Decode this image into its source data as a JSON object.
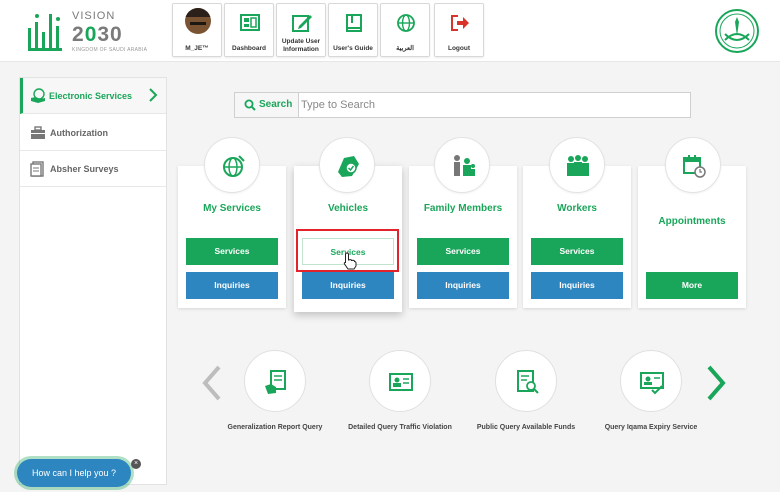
{
  "header": {
    "logo": {
      "vision_text": "VISION",
      "year_prefix": "2",
      "year_zero": "0",
      "year_suffix": "30",
      "kingdom_text": "KINGDOM OF SAUDI ARABIA"
    },
    "tiles": [
      {
        "label": "M_JE™",
        "icon": "avatar"
      },
      {
        "label": "Dashboard",
        "icon": "dashboard-icon"
      },
      {
        "label": "Update User Information",
        "icon": "edit-icon"
      },
      {
        "label": "User's Guide",
        "icon": "book-icon"
      },
      {
        "label": "العربية",
        "icon": "globe-icon"
      },
      {
        "label": "Logout",
        "icon": "logout-icon"
      }
    ]
  },
  "sidebar": {
    "items": [
      {
        "label": "Electronic Services",
        "icon": "hand-icon",
        "active": true
      },
      {
        "label": "Authorization",
        "icon": "briefcase-icon",
        "active": false
      },
      {
        "label": "Absher Surveys",
        "icon": "survey-icon",
        "active": false
      }
    ]
  },
  "search": {
    "button_label": "Search",
    "placeholder": "Type to Search"
  },
  "services": [
    {
      "title": "My Services",
      "primary": "Services",
      "secondary": "Inquiries",
      "icon": "globe-icon"
    },
    {
      "title": "Vehicles",
      "primary": "Services",
      "secondary": "Inquiries",
      "icon": "car-icon"
    },
    {
      "title": "Family Members",
      "primary": "Services",
      "secondary": "Inquiries",
      "icon": "family-icon"
    },
    {
      "title": "Workers",
      "primary": "Services",
      "secondary": "Inquiries",
      "icon": "workers-icon"
    },
    {
      "title": "Appointments",
      "more": "More",
      "icon": "calendar-icon"
    }
  ],
  "quick_access": [
    {
      "label": "Generalization Report Query",
      "icon": "report-icon"
    },
    {
      "label": "Detailed Query Traffic Violation",
      "icon": "id-card-icon"
    },
    {
      "label": "Public Query Available Funds",
      "icon": "document-search-icon"
    },
    {
      "label": "Query Iqama Expiry Service",
      "icon": "id-check-icon"
    }
  ],
  "chat": {
    "label": "How can I help you ?",
    "close": "×"
  },
  "colors": {
    "brand_green": "#1aa65a",
    "button_blue": "#2e86c1",
    "highlight_red": "#e2232b"
  }
}
